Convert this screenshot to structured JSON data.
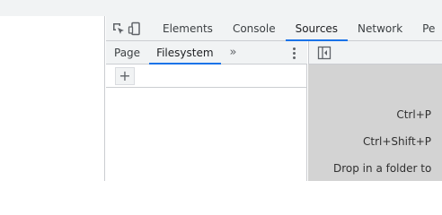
{
  "main_tabs": [
    {
      "label": "Elements"
    },
    {
      "label": "Console"
    },
    {
      "label": "Sources",
      "active": true
    },
    {
      "label": "Network"
    },
    {
      "label": "Pe"
    }
  ],
  "sources_sidebar": {
    "tabs": [
      {
        "label": "Page"
      },
      {
        "label": "Filesystem",
        "active": true
      }
    ],
    "more_tabs_glyph": "»"
  },
  "editor_hints": [
    {
      "text": "Ctrl+P"
    },
    {
      "text": "Ctrl+Shift+P"
    },
    {
      "text": "Drop in a folder to"
    }
  ],
  "icons": {
    "inspect": "inspect-element-icon",
    "device": "device-toolbar-icon",
    "kebab": "more-options-icon",
    "add": "add-folder-icon",
    "toggle": "toggle-navigator-icon"
  },
  "colors": {
    "accent": "#1a73e8",
    "toolbar_bg": "#f1f3f4",
    "editor_bg": "#d3d3d3"
  }
}
